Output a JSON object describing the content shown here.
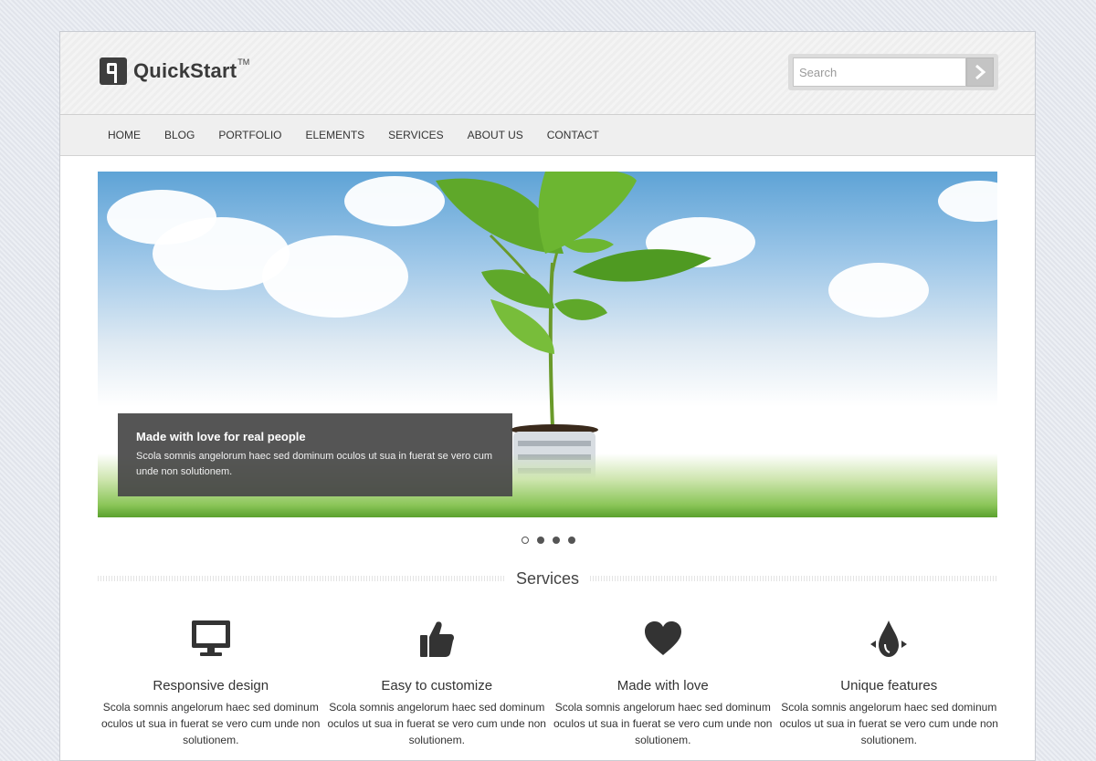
{
  "brand": {
    "name": "QuickStart",
    "tm": "TM"
  },
  "search": {
    "placeholder": "Search",
    "button_icon": "chevron-right-icon"
  },
  "nav": {
    "items": [
      "HOME",
      "BLOG",
      "PORTFOLIO",
      "ELEMENTS",
      "SERVICES",
      "ABOUT US",
      "CONTACT"
    ]
  },
  "slider": {
    "caption_title": "Made with love for real people",
    "caption_text": "Scola somnis angelorum haec sed dominum oculos ut sua in fuerat se vero cum unde non solutionem.",
    "slide_count": 4,
    "active_slide": 1
  },
  "services_section": {
    "heading": "Services",
    "items": [
      {
        "icon": "monitor-icon",
        "title": "Responsive design",
        "text": "Scola somnis angelorum haec sed dominum oculos ut sua in fuerat se vero cum unde non solutionem."
      },
      {
        "icon": "thumbs-up-icon",
        "title": "Easy to customize",
        "text": "Scola somnis angelorum haec sed dominum oculos ut sua in fuerat se vero cum unde non solutionem."
      },
      {
        "icon": "heart-icon",
        "title": "Made with love",
        "text": "Scola somnis angelorum haec sed dominum oculos ut sua in fuerat se vero cum unde non solutionem."
      },
      {
        "icon": "drop-icon",
        "title": "Unique features",
        "text": "Scola somnis angelorum haec sed dominum oculos ut sua in fuerat se vero cum unde non solutionem."
      }
    ]
  },
  "colors": {
    "accent": "#3e3e3e",
    "background": "#e6e9f0",
    "nav_bg": "#efefef"
  }
}
